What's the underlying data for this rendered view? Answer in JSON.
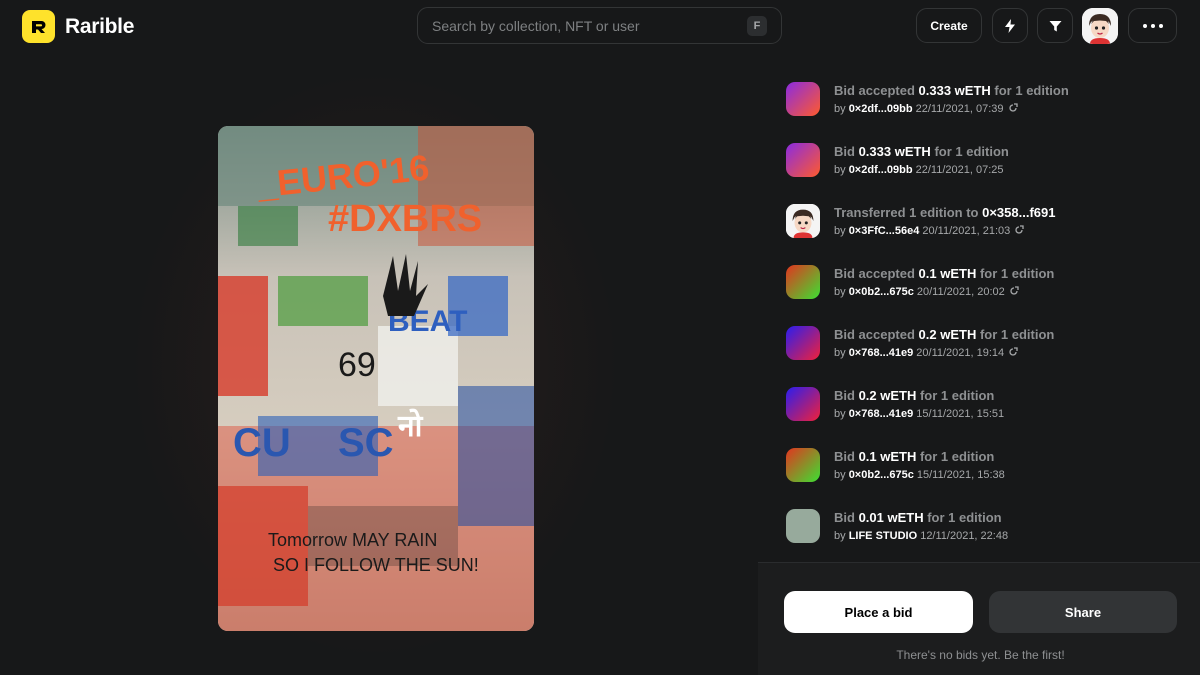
{
  "app": {
    "name": "Rarible",
    "logo_letter": "R",
    "accent": "#fee22b"
  },
  "search": {
    "placeholder": "Search by collection, NFT or user",
    "shortcut": "F"
  },
  "header": {
    "create_label": "Create",
    "bolt_icon": "bolt-icon",
    "filter_icon": "filter-icon",
    "more_icon": "more-icon"
  },
  "activity": [
    {
      "prefix": "Bid accepted ",
      "amount": "0.333 wETH",
      "suffix": " for 1 edition",
      "by": "by ",
      "who": "0×2df...09bb",
      "when": " 22/11/2021, 07:39",
      "link": true,
      "thumb": "purple-orange"
    },
    {
      "prefix": "Bid ",
      "amount": "0.333 wETH",
      "suffix": " for 1 edition",
      "by": "by ",
      "who": "0×2df...09bb",
      "when": " 22/11/2021, 07:25",
      "link": false,
      "thumb": "purple-orange"
    },
    {
      "prefix": "Transferred 1 edition to ",
      "amount": "0×358...f691",
      "suffix": "",
      "by": "by ",
      "who": "0×3FfC...56e4",
      "when": " 20/11/2021, 21:03",
      "link": true,
      "thumb": "avatar"
    },
    {
      "prefix": "Bid accepted ",
      "amount": "0.1 wETH",
      "suffix": " for 1 edition",
      "by": "by ",
      "who": "0×0b2...675c",
      "when": " 20/11/2021, 20:02",
      "link": true,
      "thumb": "green-red"
    },
    {
      "prefix": "Bid accepted ",
      "amount": "0.2 wETH",
      "suffix": " for 1 edition",
      "by": "by ",
      "who": "0×768...41e9",
      "when": " 20/11/2021, 19:14",
      "link": true,
      "thumb": "blue-red"
    },
    {
      "prefix": "Bid ",
      "amount": "0.2 wETH",
      "suffix": " for 1 edition",
      "by": "by ",
      "who": "0×768...41e9",
      "when": " 15/11/2021, 15:51",
      "link": false,
      "thumb": "blue-red"
    },
    {
      "prefix": "Bid ",
      "amount": "0.1 wETH",
      "suffix": " for 1 edition",
      "by": "by ",
      "who": "0×0b2...675c",
      "when": " 15/11/2021, 15:38",
      "link": false,
      "thumb": "green-red"
    },
    {
      "prefix": "Bid ",
      "amount": "0.01 wETH",
      "suffix": " for 1 edition",
      "by": "by ",
      "who": "LIFE STUDIO",
      "when": " 12/11/2021, 22:48",
      "link": false,
      "thumb": "sage"
    }
  ],
  "actions": {
    "bid_label": "Place a bid",
    "share_label": "Share",
    "no_bids": "There's no bids yet. Be the first!"
  }
}
